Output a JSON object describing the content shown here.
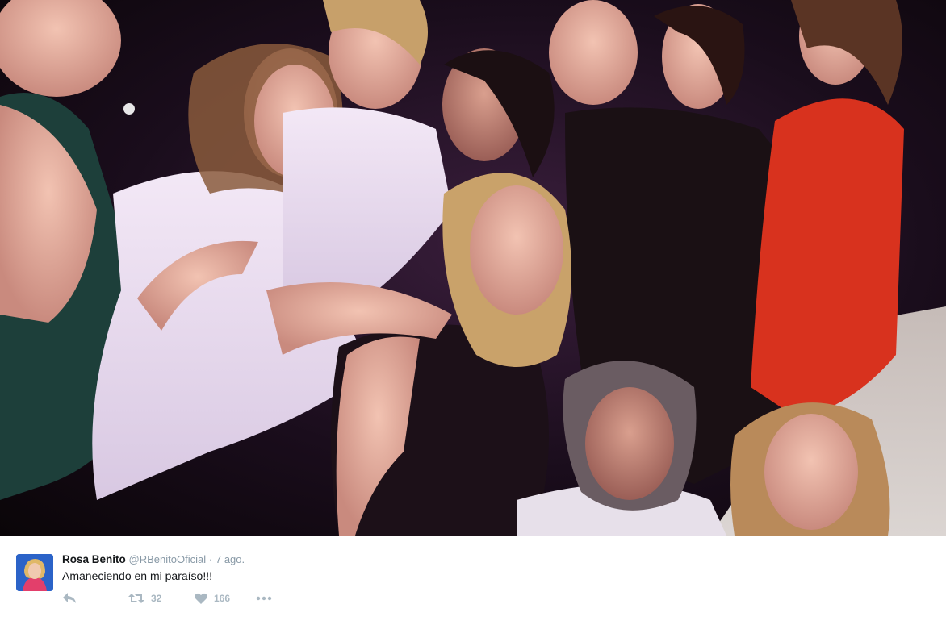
{
  "photo": {
    "icon": "group-selfie-photo"
  },
  "tweet": {
    "author_name": "Rosa Benito",
    "handle": "@RBenitoOficial",
    "separator": "·",
    "time": "7 ago.",
    "text": "Amaneciendo en mi paraíso!!!",
    "actions": {
      "reply_icon": "reply-icon",
      "retweet_icon": "retweet-icon",
      "retweet_count": "32",
      "like_icon": "heart-icon",
      "like_count": "166",
      "more_icon": "more-icon"
    }
  },
  "colors": {
    "name": "#14171a",
    "meta": "#8899a6",
    "action": "#aab8c2"
  }
}
